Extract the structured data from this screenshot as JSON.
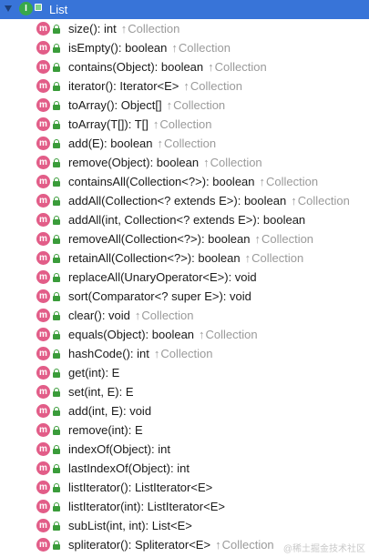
{
  "root": {
    "title": "List",
    "icon": "interface-icon",
    "badge": "I"
  },
  "method_badge": "m",
  "origin_arrow": "↑",
  "methods": [
    {
      "signature": "size(): int",
      "origin": "Collection"
    },
    {
      "signature": "isEmpty(): boolean",
      "origin": "Collection"
    },
    {
      "signature": "contains(Object): boolean",
      "origin": "Collection"
    },
    {
      "signature": "iterator(): Iterator<E>",
      "origin": "Collection"
    },
    {
      "signature": "toArray(): Object[]",
      "origin": "Collection"
    },
    {
      "signature": "toArray(T[]): T[]",
      "origin": "Collection"
    },
    {
      "signature": "add(E): boolean",
      "origin": "Collection"
    },
    {
      "signature": "remove(Object): boolean",
      "origin": "Collection"
    },
    {
      "signature": "containsAll(Collection<?>): boolean",
      "origin": "Collection"
    },
    {
      "signature": "addAll(Collection<? extends E>): boolean",
      "origin": "Collection"
    },
    {
      "signature": "addAll(int, Collection<? extends E>): boolean",
      "origin": ""
    },
    {
      "signature": "removeAll(Collection<?>): boolean",
      "origin": "Collection"
    },
    {
      "signature": "retainAll(Collection<?>): boolean",
      "origin": "Collection"
    },
    {
      "signature": "replaceAll(UnaryOperator<E>): void",
      "origin": ""
    },
    {
      "signature": "sort(Comparator<? super E>): void",
      "origin": ""
    },
    {
      "signature": "clear(): void",
      "origin": "Collection"
    },
    {
      "signature": "equals(Object): boolean",
      "origin": "Collection"
    },
    {
      "signature": "hashCode(): int",
      "origin": "Collection"
    },
    {
      "signature": "get(int): E",
      "origin": ""
    },
    {
      "signature": "set(int, E): E",
      "origin": ""
    },
    {
      "signature": "add(int, E): void",
      "origin": ""
    },
    {
      "signature": "remove(int): E",
      "origin": ""
    },
    {
      "signature": "indexOf(Object): int",
      "origin": ""
    },
    {
      "signature": "lastIndexOf(Object): int",
      "origin": ""
    },
    {
      "signature": "listIterator(): ListIterator<E>",
      "origin": ""
    },
    {
      "signature": "listIterator(int): ListIterator<E>",
      "origin": ""
    },
    {
      "signature": "subList(int, int): List<E>",
      "origin": ""
    },
    {
      "signature": "spliterator(): Spliterator<E>",
      "origin": "Collection"
    }
  ],
  "watermark": "@稀土掘金技术社区",
  "colors": {
    "selection": "#3874d8",
    "method_badge": "#e25d88",
    "interface_badge": "#38a84a",
    "lock": "#3a9c3a",
    "origin_text": "#9a9a9a"
  }
}
